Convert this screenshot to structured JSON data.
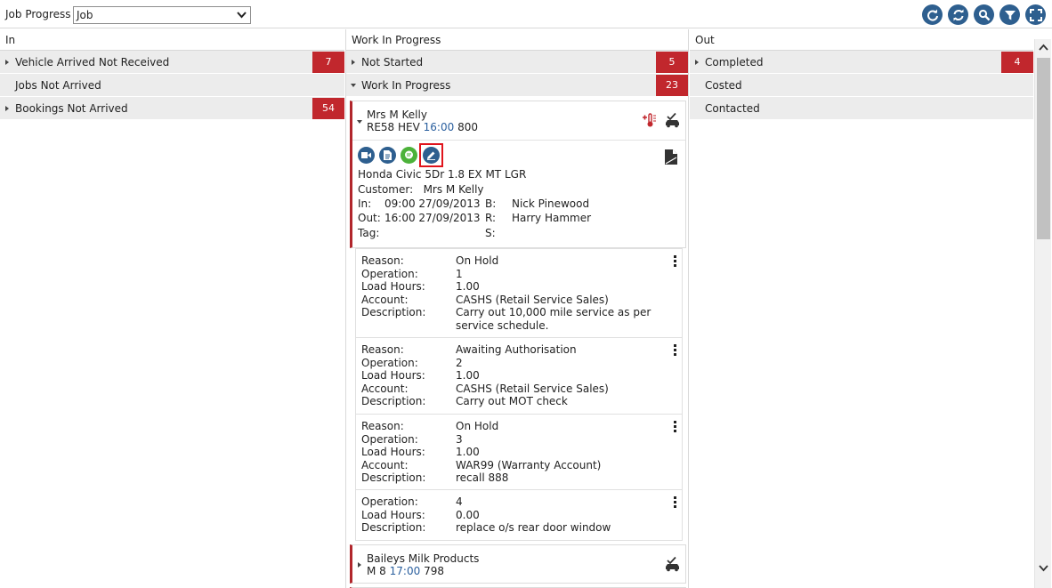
{
  "toolbar": {
    "label": "Job Progress",
    "select_value": "Job",
    "buttons": [
      "refresh-icon",
      "sync-icon",
      "search-icon",
      "filter-icon",
      "fullscreen-icon"
    ]
  },
  "colors": {
    "accent_red": "#c1272d",
    "button_blue": "#2e5f8f",
    "time_blue": "#2a5f9e"
  },
  "columns": {
    "in": {
      "title": "In",
      "groups": [
        {
          "label": "Vehicle Arrived Not Received",
          "count": "7"
        },
        {
          "label": "Jobs Not Arrived",
          "count": ""
        },
        {
          "label": "Bookings Not Arrived",
          "count": "54"
        }
      ]
    },
    "wip": {
      "title": "Work In Progress",
      "groups": [
        {
          "label": "Not Started",
          "count": "5"
        },
        {
          "label": "Work In Progress",
          "count": "23"
        }
      ]
    },
    "out": {
      "title": "Out",
      "groups": [
        {
          "label": "Completed",
          "count": "4"
        },
        {
          "label": "Costed",
          "count": ""
        },
        {
          "label": "Contacted",
          "count": ""
        }
      ]
    }
  },
  "job1": {
    "customer": "Mrs M Kelly",
    "reg": "RE58 HEV",
    "time": "16:00",
    "number": "800",
    "vehicle": "Honda Civic 5Dr 1.8 EX MT LGR",
    "customer_label": "Customer:",
    "customer_value": "Mrs M Kelly",
    "in_label": "In:",
    "in_value": "09:00 27/09/2013",
    "out_label": "Out:",
    "out_value": "16:00 27/09/2013",
    "tag_label": "Tag:",
    "b_label": "B:",
    "b_value": "Nick Pinewood",
    "r_label": "R:",
    "r_value": "Harry Hammer",
    "s_label": "S:",
    "operations": [
      {
        "reason": "On Hold",
        "operation": "1",
        "load_hours": "1.00",
        "account": "CASHS (Retail Service Sales)",
        "description": "Carry out 10,000 mile service as per service schedule."
      },
      {
        "reason": "Awaiting Authorisation",
        "operation": "2",
        "load_hours": "1.00",
        "account": "CASHS (Retail Service Sales)",
        "description": "Carry out MOT check"
      },
      {
        "reason": "On Hold",
        "operation": "3",
        "load_hours": "1.00",
        "account": "WAR99 (Warranty Account)",
        "description": "recall 888"
      },
      {
        "operation": "4",
        "load_hours": "0.00",
        "description": "replace o/s rear door window"
      }
    ]
  },
  "op_labels": {
    "reason": "Reason:",
    "operation": "Operation:",
    "load_hours": "Load Hours:",
    "account": "Account:",
    "description": "Description:"
  },
  "job2": {
    "customer": "Baileys Milk Products",
    "reg": "M 8",
    "time": "17:00",
    "number": "798"
  }
}
